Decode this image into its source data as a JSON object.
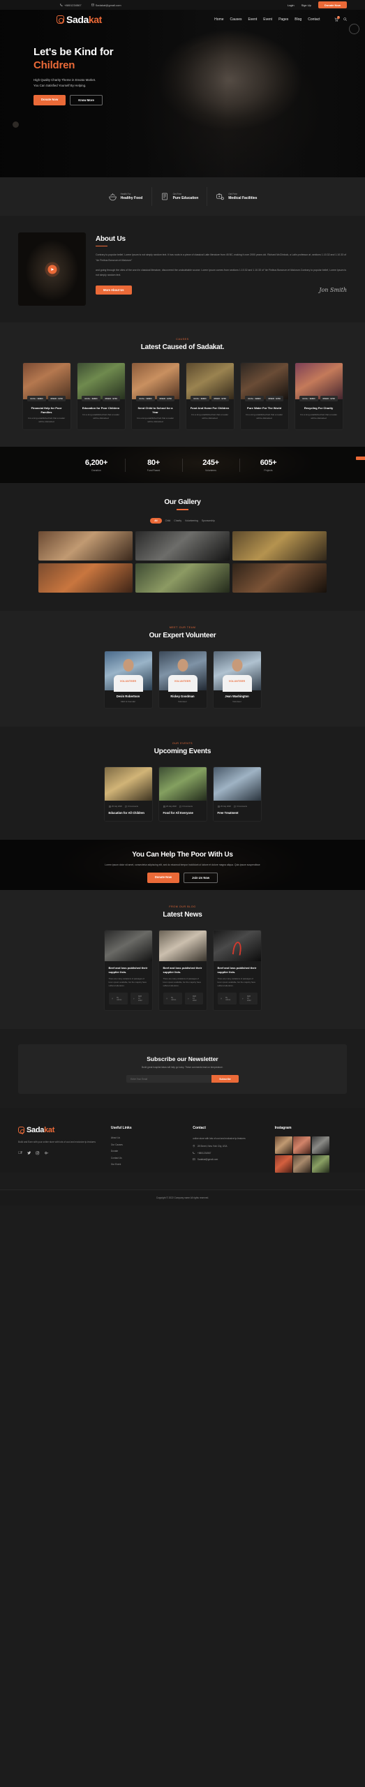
{
  "topbar": {
    "phone": "+8801234567",
    "email": "Sadakat@gmail.com",
    "login": "Login",
    "signup": "Sign Up",
    "donate": "Donate Now"
  },
  "brand": {
    "name_1": "Sada",
    "name_2": "kat"
  },
  "nav": {
    "items": [
      "Home",
      "Causes",
      "Event",
      "Event",
      "Pages",
      "Blog",
      "Contact"
    ],
    "cart_count": "0"
  },
  "hero": {
    "title_line1": "Let's be Kind for",
    "title_line2": "Children",
    "sub_line1": "High Quality Charity Theme in Envato Market.",
    "sub_line2": "You Can Satisfied Yourself By Helping.",
    "btn_primary": "Donate Now",
    "btn_secondary": "Know More"
  },
  "services": [
    {
      "top": "Health For",
      "name": "Healthy Food",
      "icon": "food-bowl-icon"
    },
    {
      "top": "Get Free",
      "name": "Pure Education",
      "icon": "book-icon"
    },
    {
      "top": "Get Free",
      "name": "Medical Facilities",
      "icon": "medical-kit-icon"
    }
  ],
  "about": {
    "kicker": "About Us",
    "title": "About Us",
    "p1": "Contrary to popular belief, Lorem Ipsum is not simply random text. It has roots in a piece of classical Latin literature from 45 BC, making it over 2000 years old. Richard McClintock, a Latin professor at ,sections 1.10.32 and 1.10.33 of \"de Finibus Bonorum et Malorum\"",
    "p2": "and going through the cites of the word in classical literature, discovered the undoubtable source. Lorem Ipsum comes from sections 1.10.32 and 1.10.33 of \"de Finibus Bonorum et Malorum.Contrary to popular belief, Lorem Ipsum is not simply random text.",
    "btn": "More About Us",
    "signature": "Jon Smith"
  },
  "causes": {
    "kicker": "CAUSES",
    "title": "Latest Caused of Sadakat.",
    "cards": [
      {
        "goal": "GOAL : $9860",
        "rised": "RISED : $768",
        "title": "Financial Help for Poor Families",
        "desc": "It is a long established fact that a reader will be distracted"
      },
      {
        "goal": "GOAL : $9860",
        "rised": "RISED : $768",
        "title": "Education for Poor Children",
        "desc": "It is a long established fact that a reader will be distracted"
      },
      {
        "goal": "GOAL : $9860",
        "rised": "RISED : $768",
        "title": "Send Child to School for a Year",
        "desc": "It is a long established fact that a reader will be distracted"
      },
      {
        "goal": "GOAL : $9860",
        "rised": "RISED : $768",
        "title": "Food And Home For Children",
        "desc": "It is a long established fact that a reader will be distracted"
      },
      {
        "goal": "GOAL : $9860",
        "rised": "RISED : $768",
        "title": "Pure Water For The World",
        "desc": "It is a long established fact that a reader will be distracted"
      },
      {
        "goal": "GOAL : $9860",
        "rised": "RISED : $768",
        "title": "Recycling For Charity",
        "desc": "It is a long established fact that a reader will be distracted"
      }
    ]
  },
  "counters": [
    {
      "number": "6,200+",
      "label": "Donation"
    },
    {
      "number": "80+",
      "label": "Fund Rased"
    },
    {
      "number": "245+",
      "label": "Volunteers"
    },
    {
      "number": "605+",
      "label": "Projects"
    }
  ],
  "gallery": {
    "title": "Our Gallery",
    "filters": [
      "All",
      "Child",
      "Charity",
      "Volunteering",
      "Sponsorship"
    ]
  },
  "volunteers": {
    "kicker": "Meet Our Team",
    "title": "Our Expert Volunteer",
    "tee_text": "VOLUNTEER",
    "members": [
      {
        "name": "Devin Robertson",
        "role": "CEO & Founder"
      },
      {
        "name": "Rickey Goodman",
        "role": "Volunteer"
      },
      {
        "name": "Jean Washington",
        "role": "Volunteer"
      }
    ]
  },
  "events": {
    "kicker": "Our Events",
    "title": "Upcoming Events",
    "items": [
      {
        "date": "25 July 2018",
        "comments": "0 Comments",
        "title": "Education for All Children"
      },
      {
        "date": "25 July 2018",
        "comments": "0 Comments",
        "title": "Food for All Everyone"
      },
      {
        "date": "25 July 2018",
        "comments": "0 Comments",
        "title": "Free Treatment"
      }
    ]
  },
  "cta": {
    "title": "You Can Help The Poor With Us",
    "text": "Lorem ipsum dolor sit amet, consectetur adipiscing elit, sed do eiusmod tempor incididunt ut labore et dolore magna aliqua. Quis ipsum suspendisse",
    "btn_primary": "Donate Now",
    "btn_secondary": "Join Us Now"
  },
  "news": {
    "kicker": "From Our Blog",
    "title": "Latest News",
    "items": [
      {
        "title": "Beef and loss published their supplier lists.",
        "desc": "There are many variations of passages of lorem ipsum available, but the majority have suffered alteration.",
        "author": "By Admin",
        "comments": "FEB 13 2022"
      },
      {
        "title": "Beef and loss published their supplier lists.",
        "desc": "There are many variations of passages of lorem ipsum available, but the majority have suffered alteration.",
        "author": "By Admin",
        "comments": "FEB 13 2022"
      },
      {
        "title": "Beef and loss published their supplier lists.",
        "desc": "There are many variations of passages of lorem ipsum available, but the majority have suffered alteration.",
        "author": "By Admin",
        "comments": "FEB 13 2022"
      }
    ]
  },
  "newsletter": {
    "title": "Subscribe our Newsletter",
    "subtitle": "Build great hospital ideas will help go lucky. These comments lead on temperature.",
    "placeholder": "Enter Your Email",
    "button": "Subscribe"
  },
  "footer": {
    "about": "Build and Earn with your online store with lots of cool and exclusive tp-features",
    "social": [
      "facebook-icon",
      "twitter-icon",
      "instagram-icon",
      "google-plus-icon"
    ],
    "links_title": "Useful Links",
    "links": [
      "About Us",
      "Our Causes",
      "Donate",
      "Contact Us",
      "Our Event"
    ],
    "contact_title": "Contact",
    "contact_text": "online store with lots of cool and exclusive tp-features",
    "address": "28 Street, New York City, USA",
    "phone": "+8801234567",
    "email": "Sadakat@gmail.com",
    "instagram_title": "Instagram",
    "copyright": "Copyright © 2022 Company name All rights reserved."
  },
  "colors": {
    "accent": "#eb6a38",
    "bg_dark": "#1c1c1c",
    "bg_alt": "#212121",
    "card": "#1a1a1a"
  }
}
